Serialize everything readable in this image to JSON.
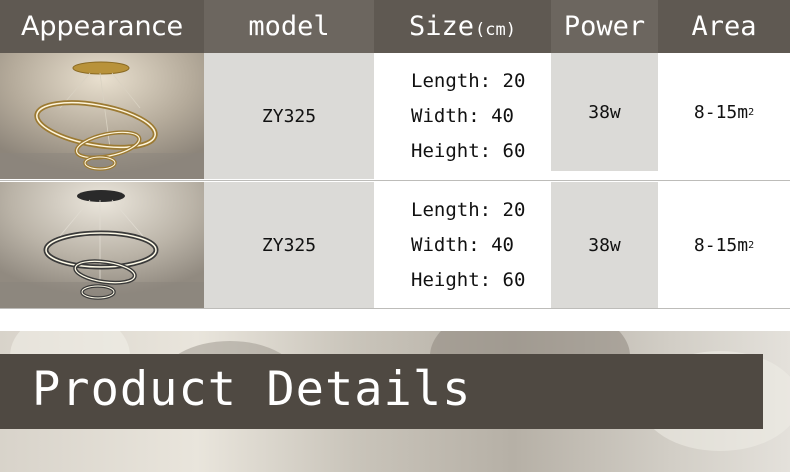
{
  "headers": {
    "appearance": "Appearance",
    "model": "model",
    "size": "Size",
    "size_unit": "(cm)",
    "power": "Power",
    "area": "Area"
  },
  "rows": [
    {
      "image": "gold-ring-chandelier",
      "model": "ZY325",
      "length": "Length: 20",
      "width": "Width: 40",
      "height": "Height: 60",
      "power": "38w",
      "area": "8-15m",
      "area_sup": "2"
    },
    {
      "image": "black-ring-chandelier",
      "model": "ZY325",
      "length": "Length: 20",
      "width": "Width: 40",
      "height": "Height: 60",
      "power": "38w",
      "area": "8-15m",
      "area_sup": "2"
    }
  ],
  "banner": {
    "title": "Product Details"
  },
  "colors": {
    "header_bg": "#5f5952",
    "gray_cell": "#dbdad7",
    "banner_bar": "#4f4942"
  }
}
